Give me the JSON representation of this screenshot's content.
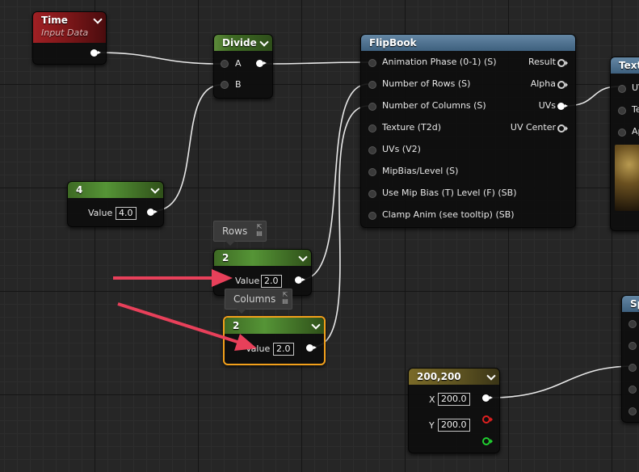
{
  "nodes": {
    "time": {
      "title": "Time",
      "subtitle": "Input Data"
    },
    "divide": {
      "title": "Divide",
      "pin_a": "A",
      "pin_b": "B"
    },
    "const4": {
      "title": "4",
      "value_label": "Value",
      "value": "4.0"
    },
    "rows": {
      "comment": "Rows",
      "title": "2",
      "value_label": "Value",
      "value": "2.0"
    },
    "columns": {
      "comment": "Columns",
      "title": "2",
      "value_label": "Value",
      "value": "2.0"
    },
    "flipbook": {
      "title": "FlipBook",
      "inputs": [
        "Animation  Phase (0-1) (S)",
        "Number of Rows (S)",
        "Number of Columns (S)",
        "Texture (T2d)",
        "UVs (V2)",
        "MipBias/Level (S)",
        "Use Mip Bias (T) Level (F) (SB)",
        "Clamp Anim (see tooltip) (SB)"
      ],
      "outputs": [
        "Result",
        "Alpha",
        "UVs",
        "UV Center"
      ]
    },
    "vec2": {
      "title": "200,200",
      "x_label": "X",
      "x_value": "200.0",
      "y_label": "Y",
      "y_value": "200.0"
    },
    "texture": {
      "title": "Textu",
      "pins": [
        "UV",
        "Te",
        "Ap"
      ]
    },
    "partial": {
      "title": "Sp"
    }
  },
  "colors": {
    "selection": "#f2a01b",
    "annotation_arrow": "#e8405a",
    "wire": "#e8e8e8",
    "x_pin": "#e02020",
    "y_pin": "#20d030"
  }
}
